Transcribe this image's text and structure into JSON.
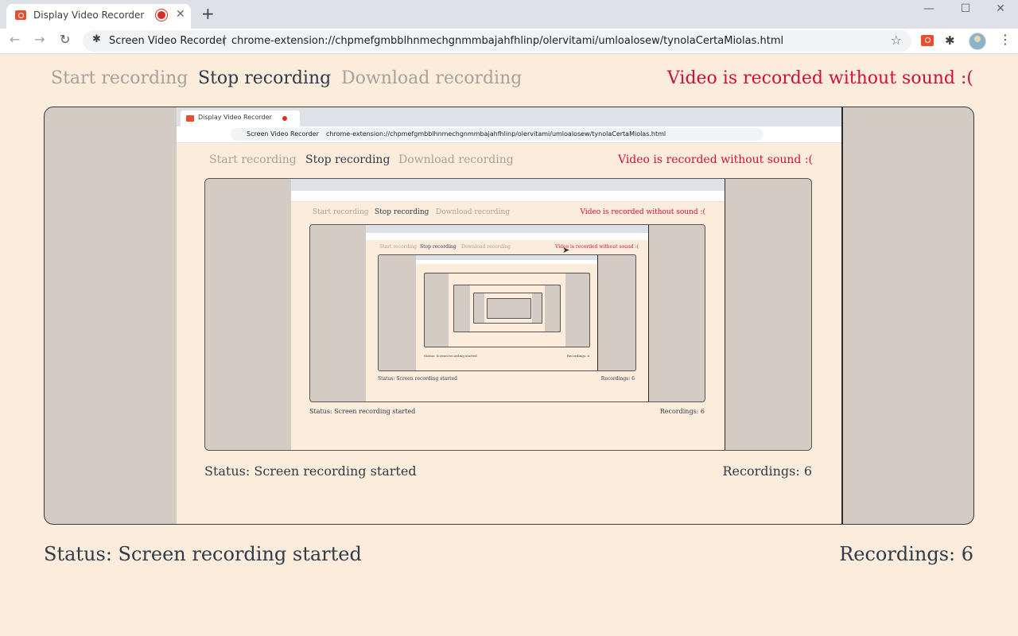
{
  "browser": {
    "tab_title": "Display Video Recorder",
    "tab_close": "✕",
    "new_tab": "+",
    "window_controls": {
      "minimize": "—",
      "maximize": "☐",
      "close": "✕"
    },
    "nav": {
      "back": "←",
      "forward": "→",
      "reload": "↻"
    },
    "site_name": "Screen Video Recorder",
    "separator": "|",
    "url": "chrome-extension://chpmefgmbblhnmechgnmmbajahfhlinp/olervitami/umloalosew/tynolaCertaMiolas.html",
    "star": "☆",
    "puzzle": "✱",
    "menu": "⋮",
    "icons": [
      "record-icon",
      "puzzle-icon",
      "avatar",
      "star-icon",
      "menu-icon"
    ]
  },
  "page": {
    "menu": {
      "start": "Start recording",
      "stop": "Stop recording",
      "download": "Download recording"
    },
    "warning": "Video is recorded without sound :(",
    "status": "Status: Screen recording started",
    "recordings": "Recordings: 6"
  },
  "colors": {
    "page_bg": "#fcecdc",
    "preview_bg": "#d4ccc4",
    "accent_red": "#d0103a",
    "text_dark": "#2f3b4a",
    "text_dim": "#a6a29b"
  }
}
